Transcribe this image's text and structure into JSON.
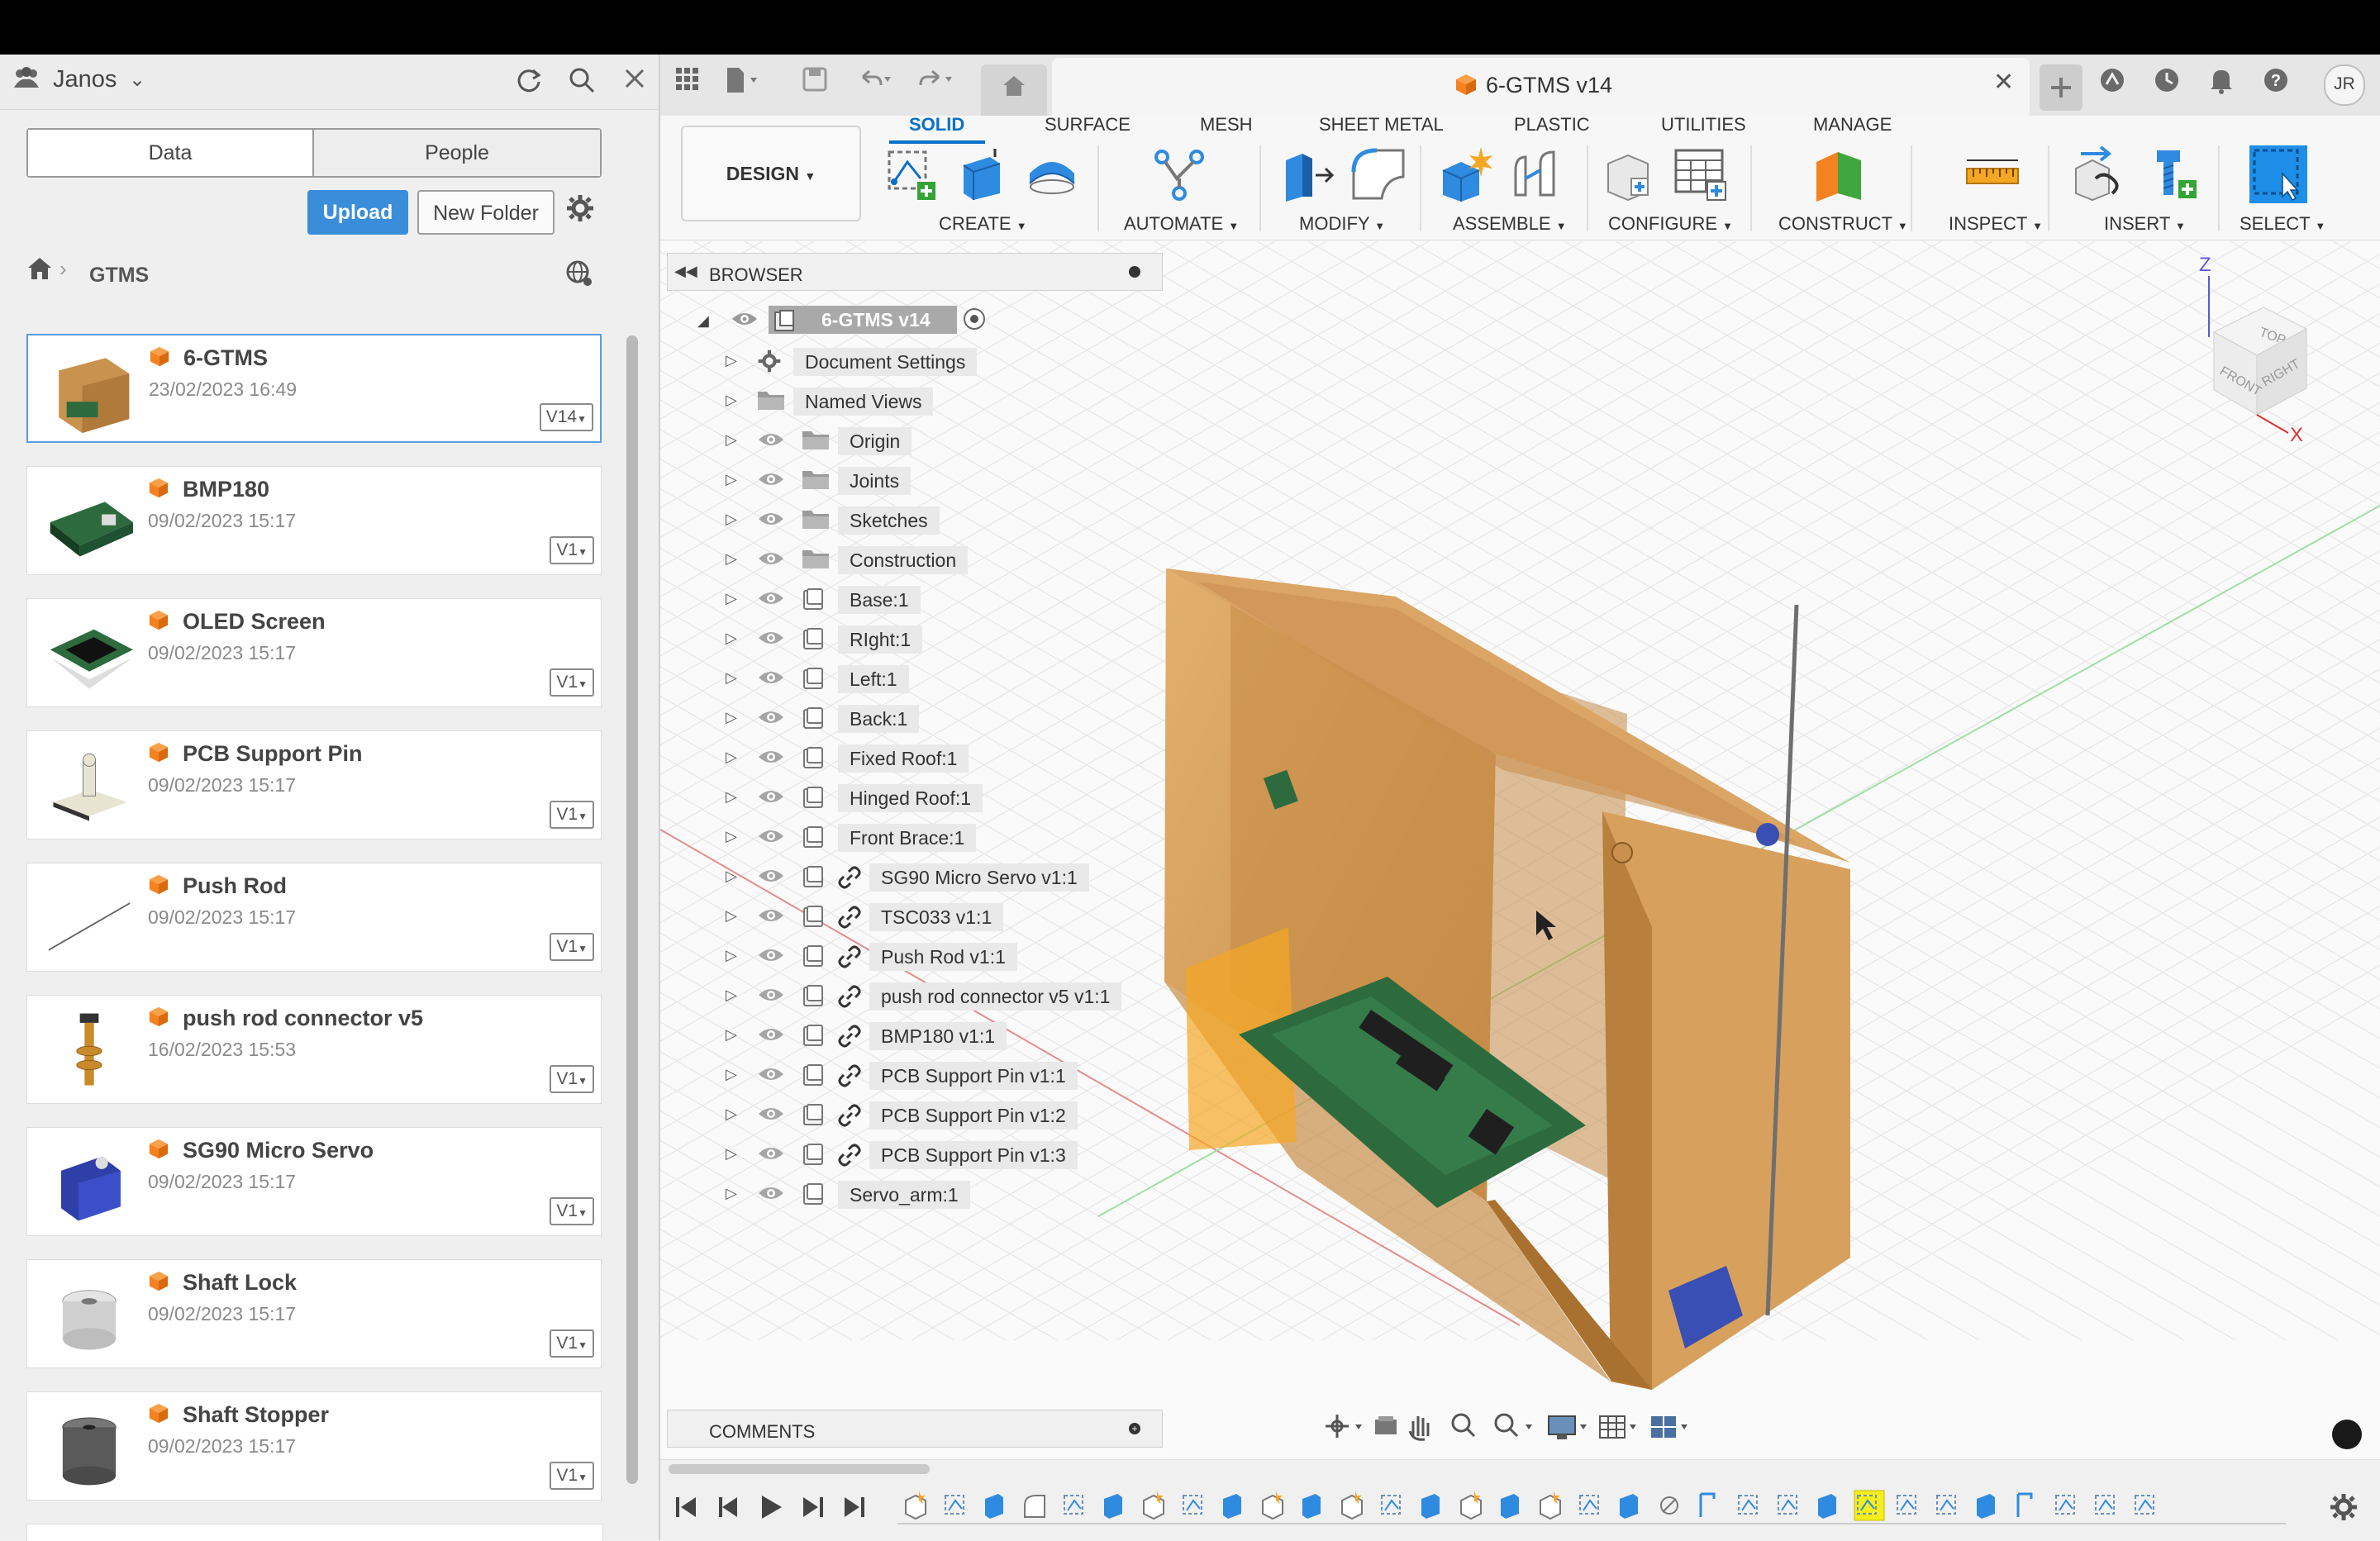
{
  "left_panel": {
    "team_name": "Janos",
    "tabs": [
      "Data",
      "People"
    ],
    "upload_label": "Upload",
    "new_folder_label": "New Folder",
    "breadcrumb": "GTMS",
    "files": [
      {
        "name": "6-GTMS",
        "date": "23/02/2023 16:49",
        "version": "V14"
      },
      {
        "name": "BMP180",
        "date": "09/02/2023 15:17",
        "version": "V1"
      },
      {
        "name": "OLED Screen",
        "date": "09/02/2023 15:17",
        "version": "V1"
      },
      {
        "name": "PCB Support Pin",
        "date": "09/02/2023 15:17",
        "version": "V1"
      },
      {
        "name": "Push Rod",
        "date": "09/02/2023 15:17",
        "version": "V1"
      },
      {
        "name": "push rod connector v5",
        "date": "16/02/2023 15:53",
        "version": "V1"
      },
      {
        "name": "SG90 Micro Servo",
        "date": "09/02/2023 15:17",
        "version": "V1"
      },
      {
        "name": "Shaft Lock",
        "date": "09/02/2023 15:17",
        "version": "V1"
      },
      {
        "name": "Shaft Stopper",
        "date": "09/02/2023 15:17",
        "version": "V1"
      }
    ]
  },
  "document": {
    "title": "6-GTMS v14",
    "user_initials": "JR"
  },
  "ribbon": {
    "workspace": "DESIGN",
    "tabs": [
      "SOLID",
      "SURFACE",
      "MESH",
      "SHEET METAL",
      "PLASTIC",
      "UTILITIES",
      "MANAGE"
    ],
    "active_tab": "SOLID",
    "groups": [
      "CREATE",
      "AUTOMATE",
      "MODIFY",
      "ASSEMBLE",
      "CONFIGURE",
      "CONSTRUCT",
      "INSPECT",
      "INSERT",
      "SELECT"
    ]
  },
  "browser": {
    "title": "BROWSER",
    "root": "6-GTMS v14",
    "items": [
      {
        "label": "Document Settings",
        "icon": "gear-icon",
        "eye": false,
        "link": false
      },
      {
        "label": "Named Views",
        "icon": "folder-icon",
        "eye": false,
        "link": false
      },
      {
        "label": "Origin",
        "icon": "folder-icon",
        "eye": true,
        "link": false
      },
      {
        "label": "Joints",
        "icon": "folder-icon",
        "eye": true,
        "link": false
      },
      {
        "label": "Sketches",
        "icon": "folder-icon",
        "eye": true,
        "link": false
      },
      {
        "label": "Construction",
        "icon": "folder-icon",
        "eye": true,
        "link": false
      },
      {
        "label": "Base:1",
        "icon": "component-icon",
        "eye": true,
        "link": false
      },
      {
        "label": "RIght:1",
        "icon": "component-icon",
        "eye": true,
        "link": false
      },
      {
        "label": "Left:1",
        "icon": "component-icon",
        "eye": true,
        "link": false
      },
      {
        "label": "Back:1",
        "icon": "component-icon",
        "eye": true,
        "link": false
      },
      {
        "label": "Fixed Roof:1",
        "icon": "component-icon",
        "eye": true,
        "link": false
      },
      {
        "label": "Hinged Roof:1",
        "icon": "component-icon",
        "eye": true,
        "link": false
      },
      {
        "label": "Front Brace:1",
        "icon": "component-icon",
        "eye": true,
        "link": false
      },
      {
        "label": "SG90 Micro Servo v1:1",
        "icon": "component-icon",
        "eye": true,
        "link": true
      },
      {
        "label": "TSC033 v1:1",
        "icon": "component-icon",
        "eye": true,
        "link": true
      },
      {
        "label": "Push Rod v1:1",
        "icon": "component-icon",
        "eye": true,
        "link": true
      },
      {
        "label": "push rod connector v5 v1:1",
        "icon": "component-icon",
        "eye": true,
        "link": true
      },
      {
        "label": "BMP180 v1:1",
        "icon": "component-icon",
        "eye": true,
        "link": true
      },
      {
        "label": "PCB Support Pin v1:1",
        "icon": "component-icon",
        "eye": true,
        "link": true
      },
      {
        "label": "PCB Support Pin v1:2",
        "icon": "component-icon",
        "eye": true,
        "link": true
      },
      {
        "label": "PCB Support Pin v1:3",
        "icon": "component-icon",
        "eye": true,
        "link": true
      },
      {
        "label": "Servo_arm:1",
        "icon": "component-icon",
        "eye": true,
        "link": false
      }
    ]
  },
  "comments_title": "COMMENTS",
  "viewcube": {
    "faces": [
      "TOP",
      "FRONT",
      "RIGHT"
    ],
    "axes": [
      "Z",
      "X"
    ]
  },
  "colors": {
    "accent": "#0a70c8",
    "upload": "#3a8ed9",
    "brand_orange": "#f58220",
    "wood": "#c9924e"
  }
}
